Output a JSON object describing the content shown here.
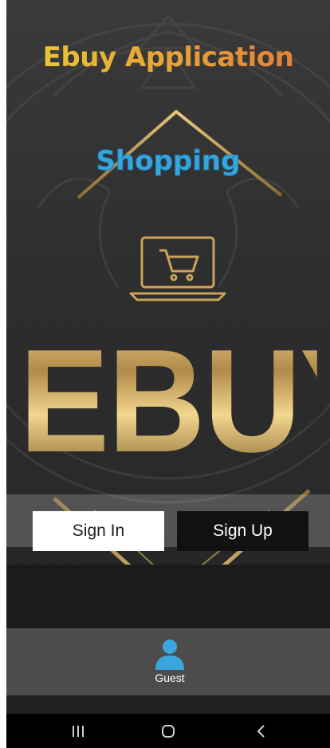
{
  "app": {
    "title": "Ebuy Application",
    "subtitle": "Shopping",
    "brand_text": "EBUY"
  },
  "auth": {
    "signin_label": "Sign In",
    "signup_label": "Sign Up"
  },
  "bottom_nav": {
    "items": [
      {
        "label": "Guest",
        "icon": "user-icon",
        "active": true
      }
    ]
  },
  "system_nav": {
    "recents_icon": "recent-apps-icon",
    "home_icon": "home-circle-icon",
    "back_icon": "back-chevron-icon"
  },
  "colors": {
    "title_gradient_start": "#f6d73a",
    "title_gradient_end": "#ee7f3c",
    "subtitle": "#37a6dd",
    "gold": "#c9a35a",
    "guest_icon": "#3aa6dd"
  }
}
